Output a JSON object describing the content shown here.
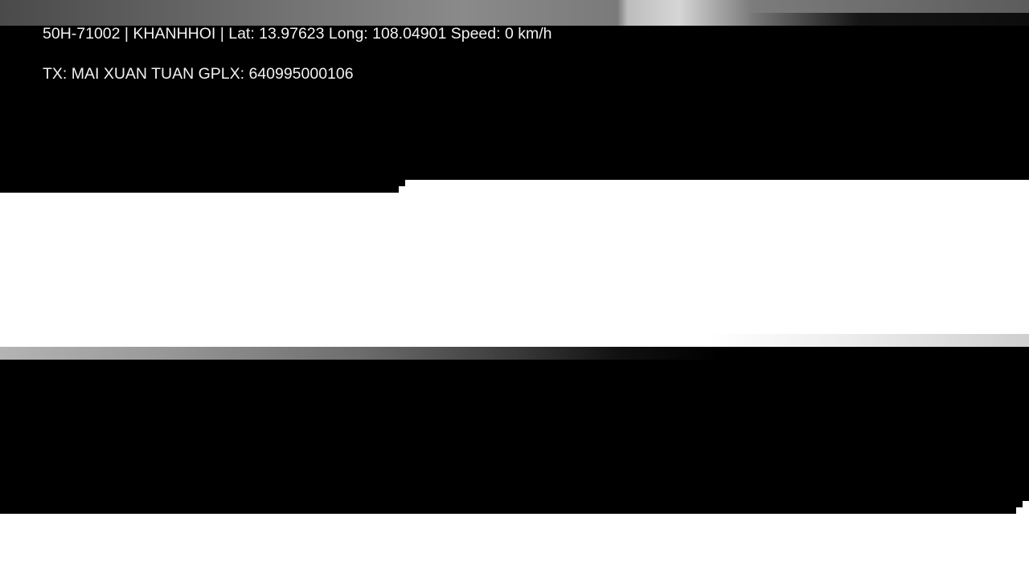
{
  "overlay": {
    "line1": "50H-71002 | KHANHHOI | Lat: 13.97623 Long: 108.04901 Speed: 0 km/h",
    "line2": "TX: MAI XUAN TUAN GPLX: 640995000106"
  },
  "colors": {
    "overlay_text": "#f2f2f2",
    "block": "#000000",
    "background": "#ffffff"
  }
}
